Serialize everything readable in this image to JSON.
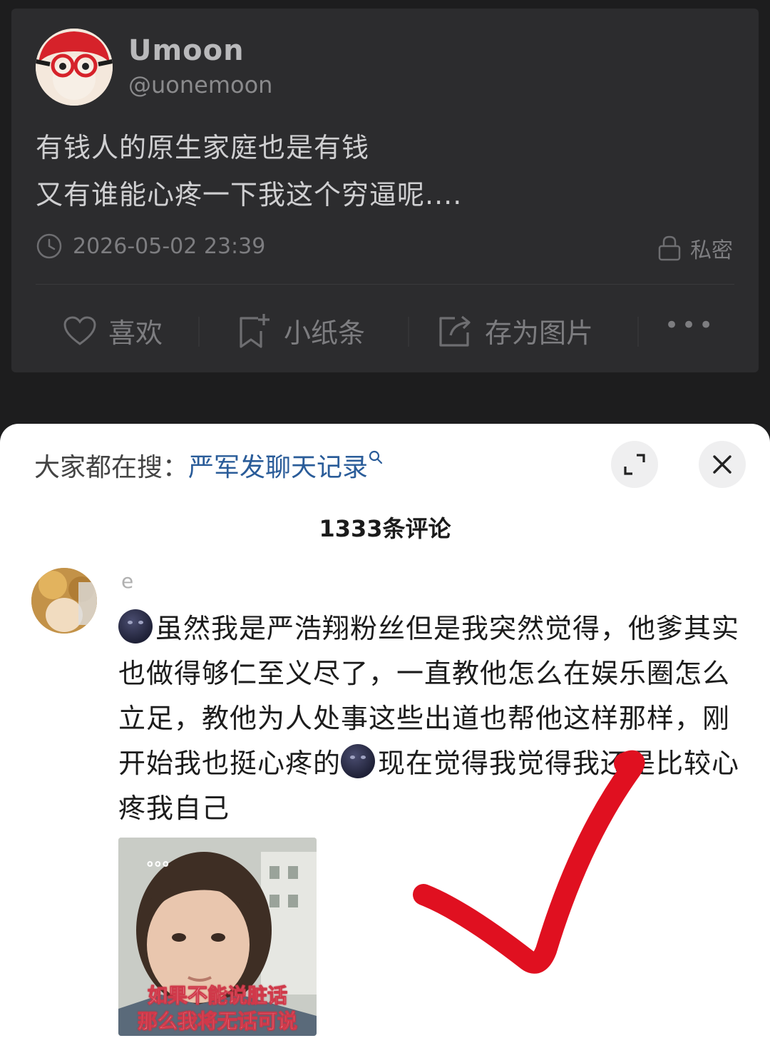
{
  "post": {
    "author_name": "Umoon",
    "author_handle": "@uonemoon",
    "text_line1": "有钱人的原生家庭也是有钱",
    "text_line2": "又有谁能心疼一下我这个穷逼呢....",
    "timestamp": "2026-05-02 23:39",
    "privacy_label": "私密",
    "actions": {
      "like": "喜欢",
      "note": "小纸条",
      "save_image": "存为图片",
      "more": "•••"
    }
  },
  "sheet": {
    "search_prefix": "大家都在搜：",
    "search_term": "严军发聊天记录",
    "comment_count": "1333条评论",
    "comment": {
      "username": "e",
      "text_part1": "虽然我是严浩翔粉丝但是我突然觉得，他爹其实也做得够仁至义尽了，一直教他怎么在娱乐圈怎么立足，教他为人处事这些出道也帮他这样那样，刚开始我也挺心疼的",
      "text_part2": "现在觉得我觉得我还是比较心疼我自己",
      "image_caption_line1": "如果不能说脏话",
      "image_caption_line2": "那么我将无话可说",
      "image_dots": "。。。"
    }
  },
  "icons": [
    "clock-icon",
    "lock-icon",
    "heart-icon",
    "note-add-icon",
    "share-icon",
    "more-icon",
    "search-icon",
    "expand-icon",
    "close-icon",
    "moon-emoji-icon"
  ],
  "colors": {
    "background": "#1d1d1e",
    "card": "#2c2c2e",
    "search_link": "#2a5c99",
    "checkmark": "#e01020"
  }
}
